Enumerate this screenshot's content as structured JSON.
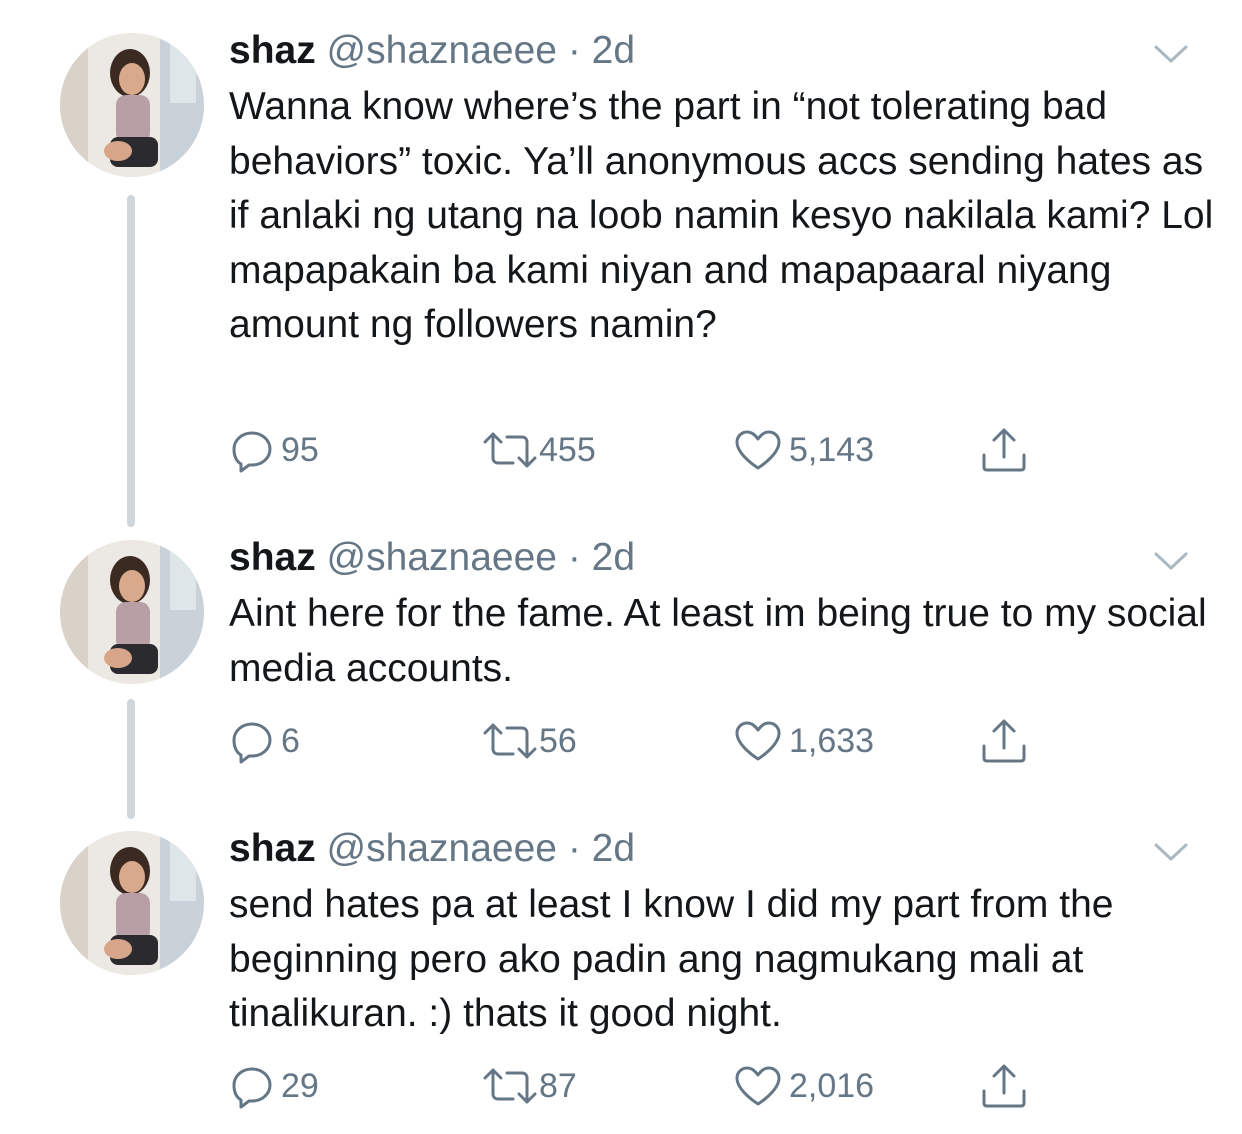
{
  "colors": {
    "text": "#14171a",
    "secondary": "#657786",
    "thread_line": "#cfd6dc",
    "icon": "#657786"
  },
  "tweets": [
    {
      "name": "shaz",
      "handle": "@shaznaeee",
      "separator": "·",
      "time": "2d",
      "text": "Wanna know where’s the part in “not tolerating bad behaviors” toxic. Ya’ll anonymous accs sending hates as if anlaki ng utang na loob namin kesyo nakilala kami? Lol mapapakain ba kami niyan and mapapaaral niyang amount ng followers namin?",
      "replies": "95",
      "retweets": "455",
      "likes": "5,143"
    },
    {
      "name": "shaz",
      "handle": "@shaznaeee",
      "separator": "·",
      "time": "2d",
      "text": "Aint here for the fame. At least im being true to my social media accounts.",
      "replies": "6",
      "retweets": "56",
      "likes": "1,633"
    },
    {
      "name": "shaz",
      "handle": "@shaznaeee",
      "separator": "·",
      "time": "2d",
      "text": "send hates pa at least I know I did my part from the beginning pero ako padin ang nagmukang mali at tinalikuran. :) thats it good night.",
      "replies": "29",
      "retweets": "87",
      "likes": "2,016"
    }
  ],
  "icons": {
    "reply": "reply-icon",
    "retweet": "retweet-icon",
    "like": "heart-icon",
    "share": "share-icon",
    "menu": "chevron-down-icon"
  }
}
